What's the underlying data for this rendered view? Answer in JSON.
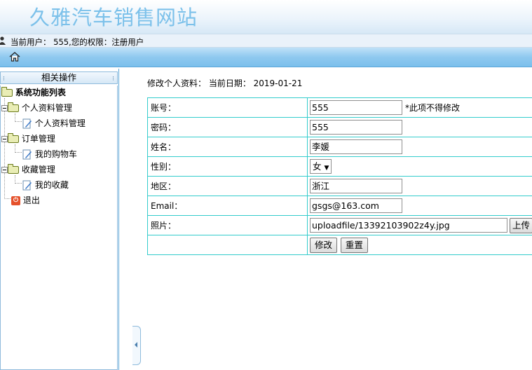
{
  "header": {
    "title": "久雅汽车销售网站"
  },
  "userbar": {
    "text": "当前用户： 555,您的权限：注册用户"
  },
  "sidebar": {
    "heading": "相关操作",
    "root": "系统功能列表",
    "groups": [
      {
        "label": "个人资料管理",
        "items": [
          "个人资料管理"
        ]
      },
      {
        "label": "订单管理",
        "items": [
          "我的购物车"
        ]
      },
      {
        "label": "收藏管理",
        "items": [
          "我的收藏"
        ]
      }
    ],
    "exit": "退出"
  },
  "content": {
    "heading": "修改个人资料： 当前日期： 2019-01-21",
    "fields": {
      "account": {
        "label": "账号：",
        "value": "555",
        "note": "*此项不得修改"
      },
      "password": {
        "label": "密码：",
        "value": "555"
      },
      "name": {
        "label": "姓名：",
        "value": "李媛"
      },
      "gender": {
        "label": "性别：",
        "value": "女"
      },
      "region": {
        "label": "地区：",
        "value": "浙江"
      },
      "email": {
        "label": "Email：",
        "value": "gsgs@163.com"
      },
      "photo": {
        "label": "照片：",
        "value": "uploadfile/13392103902z4y.jpg",
        "upload_label": "上传"
      }
    },
    "buttons": {
      "modify": "修改",
      "reset": "重置"
    }
  },
  "icons": [
    "user-icon",
    "home-icon",
    "folder-icon",
    "page-edit-icon",
    "exit-icon",
    "collapse-arrow-icon"
  ]
}
